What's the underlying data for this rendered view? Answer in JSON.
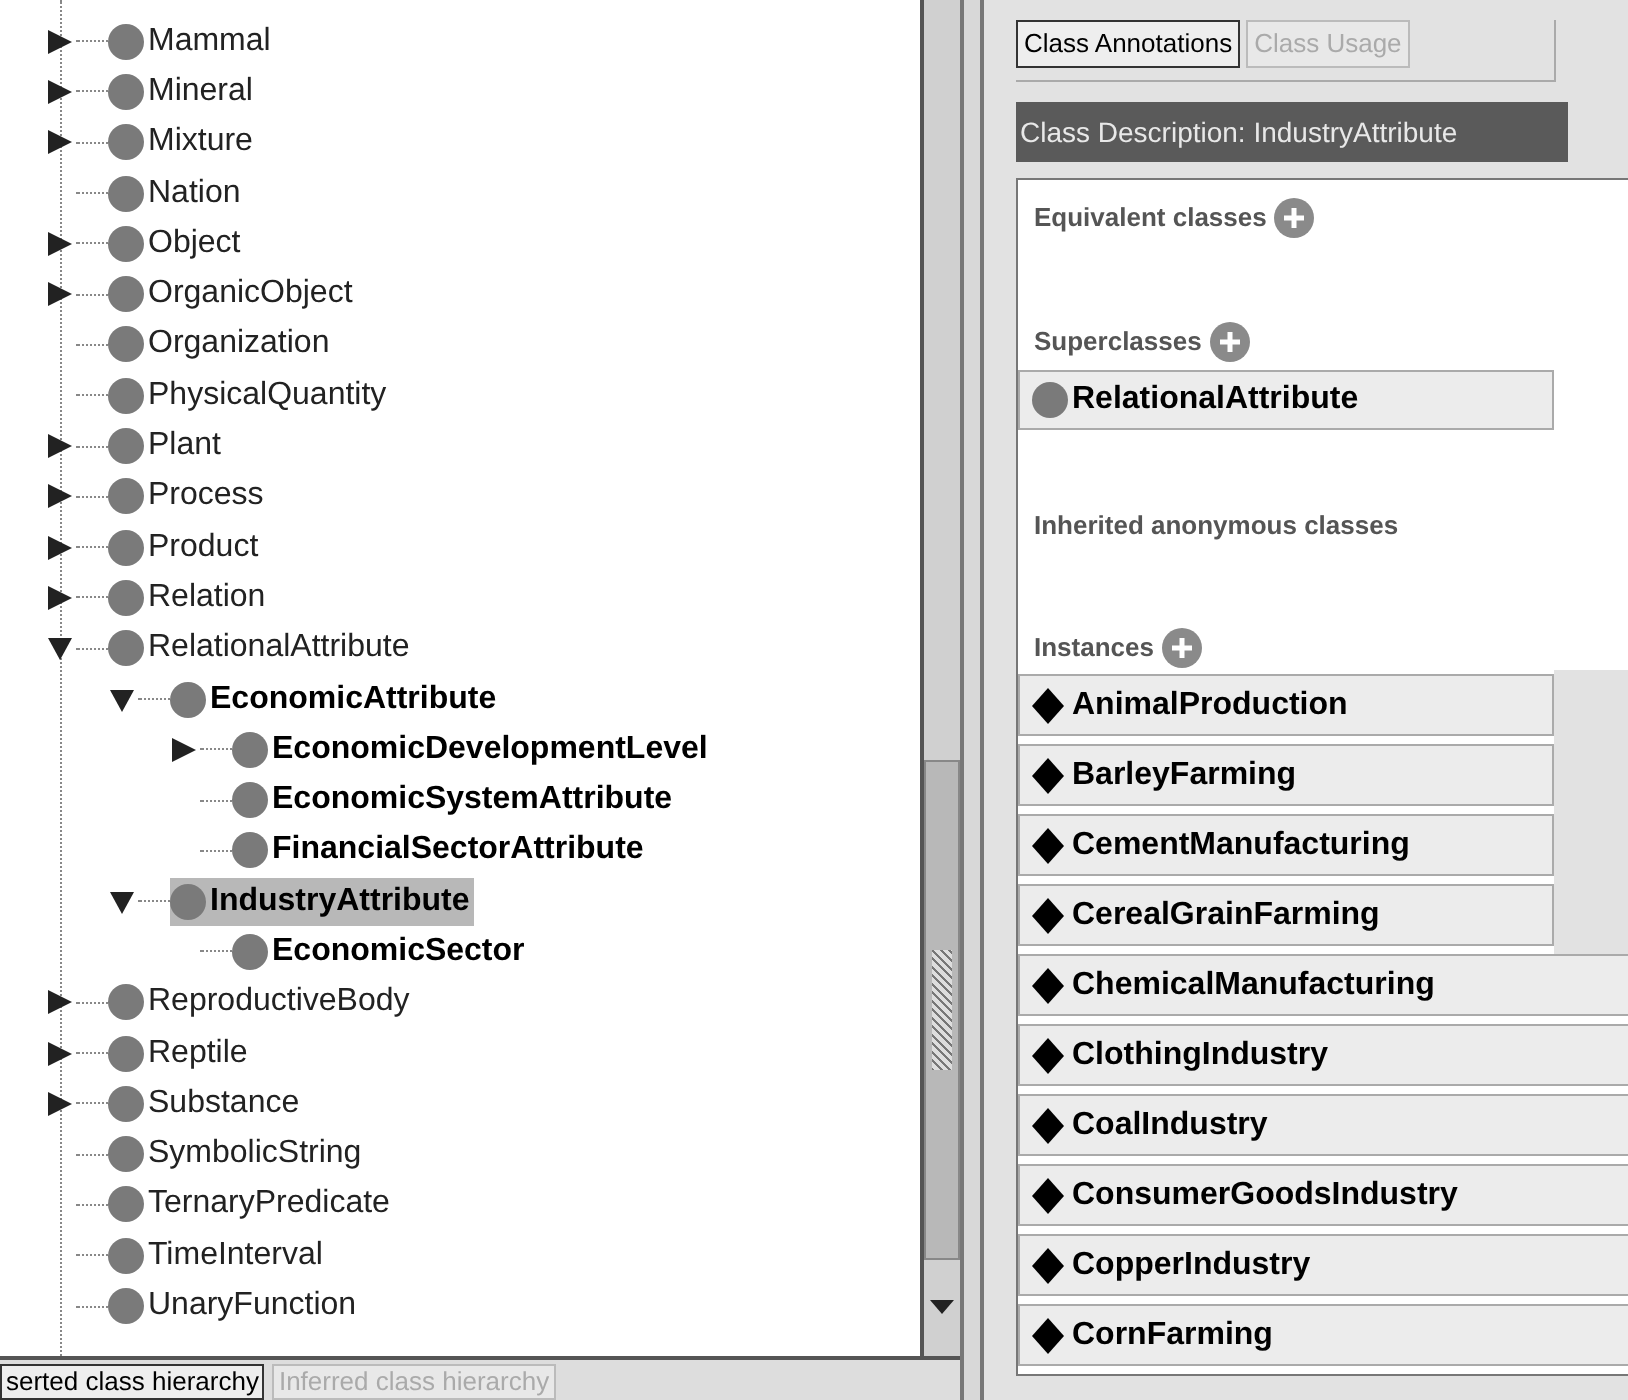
{
  "class_tree": [
    {
      "name": "Mammal",
      "kind": "collapsed",
      "selected": false,
      "bold": false
    },
    {
      "name": "Mineral",
      "kind": "collapsed",
      "selected": false,
      "bold": false
    },
    {
      "name": "Mixture",
      "kind": "collapsed",
      "selected": false,
      "bold": false
    },
    {
      "name": "Nation",
      "kind": "leaf",
      "selected": false,
      "bold": false
    },
    {
      "name": "Object",
      "kind": "collapsed",
      "selected": false,
      "bold": false
    },
    {
      "name": "OrganicObject",
      "kind": "collapsed",
      "selected": false,
      "bold": false
    },
    {
      "name": "Organization",
      "kind": "leaf",
      "selected": false,
      "bold": false
    },
    {
      "name": "PhysicalQuantity",
      "kind": "leaf",
      "selected": false,
      "bold": false
    },
    {
      "name": "Plant",
      "kind": "collapsed",
      "selected": false,
      "bold": false
    },
    {
      "name": "Process",
      "kind": "collapsed",
      "selected": false,
      "bold": false
    },
    {
      "name": "Product",
      "kind": "collapsed",
      "selected": false,
      "bold": false
    },
    {
      "name": "Relation",
      "kind": "collapsed",
      "selected": false,
      "bold": false
    },
    {
      "name": "RelationalAttribute",
      "kind": "expanded",
      "selected": false,
      "bold": false,
      "children": [
        {
          "name": "EconomicAttribute",
          "kind": "expanded",
          "selected": false,
          "bold": true,
          "children": [
            {
              "name": "EconomicDevelopmentLevel",
              "kind": "collapsed",
              "selected": false,
              "bold": true
            },
            {
              "name": "EconomicSystemAttribute",
              "kind": "leaf",
              "selected": false,
              "bold": true
            },
            {
              "name": "FinancialSectorAttribute",
              "kind": "leaf",
              "selected": false,
              "bold": true
            }
          ]
        },
        {
          "name": "IndustryAttribute",
          "kind": "expanded",
          "selected": true,
          "bold": true,
          "children": [
            {
              "name": "EconomicSector",
              "kind": "leaf",
              "selected": false,
              "bold": true
            }
          ]
        }
      ]
    },
    {
      "name": "ReproductiveBody",
      "kind": "collapsed",
      "selected": false,
      "bold": false
    },
    {
      "name": "Reptile",
      "kind": "collapsed",
      "selected": false,
      "bold": false
    },
    {
      "name": "Substance",
      "kind": "collapsed",
      "selected": false,
      "bold": false
    },
    {
      "name": "SymbolicString",
      "kind": "leaf",
      "selected": false,
      "bold": false
    },
    {
      "name": "TernaryPredicate",
      "kind": "leaf",
      "selected": false,
      "bold": false
    },
    {
      "name": "TimeInterval",
      "kind": "leaf",
      "selected": false,
      "bold": false
    },
    {
      "name": "UnaryFunction",
      "kind": "leaf",
      "selected": false,
      "bold": false
    }
  ],
  "hierarchy_tabs": [
    {
      "label": "serted class hierarchy",
      "selected": true
    },
    {
      "label": "Inferred class hierarchy",
      "selected": false
    }
  ],
  "view_tabs": [
    {
      "label": "Class Annotations",
      "selected": true
    },
    {
      "label": "Class Usage",
      "selected": false
    }
  ],
  "class_description": {
    "title": "Class Description: IndustryAttribute",
    "equivalent_classes": {
      "label": "Equivalent classes"
    },
    "superclasses": {
      "label": "Superclasses",
      "items": [
        "RelationalAttribute"
      ]
    },
    "inherited_anonymous_classes": {
      "label": "Inherited anonymous classes"
    },
    "instances": {
      "label": "Instances",
      "items": [
        "AnimalProduction",
        "BarleyFarming",
        "CementManufacturing",
        "CerealGrainFarming",
        "ChemicalManufacturing",
        "ClothingIndustry",
        "CoalIndustry",
        "ConsumerGoodsIndustry",
        "CopperIndustry",
        "CornFarming"
      ]
    }
  }
}
